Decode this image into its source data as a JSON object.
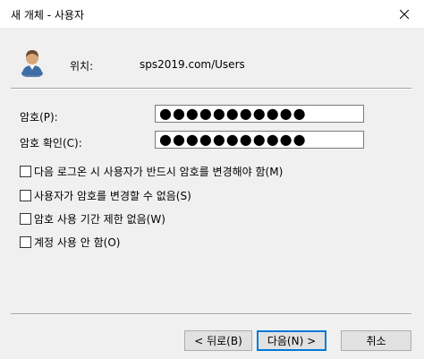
{
  "window": {
    "title": "새 개체 - 사용자"
  },
  "location": {
    "label": "위치:",
    "value": "sps2019.com/Users"
  },
  "fields": {
    "password_label": "암호(P):",
    "password_value": "●●●●●●●●●●●",
    "confirm_label": "암호 확인(C):",
    "confirm_value": "●●●●●●●●●●●"
  },
  "options": [
    {
      "label": "다음 로그온 시 사용자가 반드시 암호를 변경해야 함(M)",
      "checked": false
    },
    {
      "label": "사용자가 암호를 변경할 수 없음(S)",
      "checked": false
    },
    {
      "label": "암호 사용 기간 제한 없음(W)",
      "checked": false
    },
    {
      "label": "계정 사용 안 함(O)",
      "checked": false
    }
  ],
  "buttons": {
    "back": "< 뒤로(B)",
    "next": "다음(N) >",
    "cancel": "취소"
  },
  "icons": {
    "close": "close-icon",
    "user": "user-avatar-icon"
  },
  "colors": {
    "dialog_background": "#f0f0f0",
    "default_button_border": "#0078d7"
  }
}
